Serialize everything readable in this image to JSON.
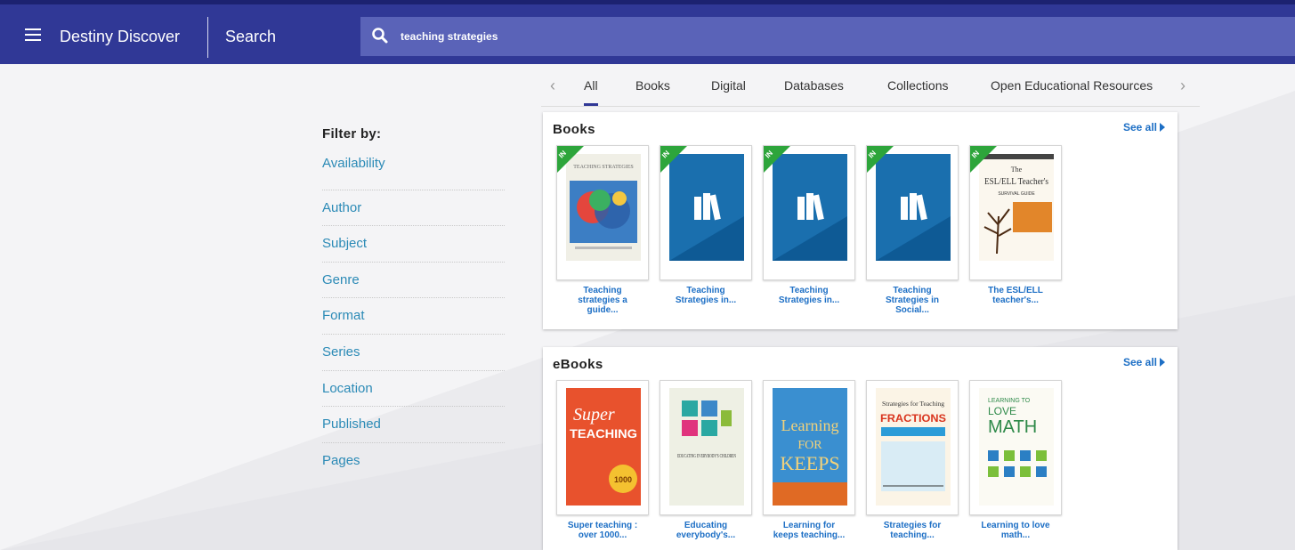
{
  "header": {
    "app_title": "Destiny Discover",
    "page_label": "Search",
    "search_value": "teaching strategies",
    "colors": {
      "bar": "#303896",
      "search_bg": "#5a63b8"
    }
  },
  "filters": {
    "heading": "Filter by:",
    "items": [
      "Availability",
      "Author",
      "Subject",
      "Genre",
      "Format",
      "Series",
      "Location",
      "Published",
      "Pages"
    ]
  },
  "tabs": {
    "items": [
      "All",
      "Books",
      "Digital",
      "Databases",
      "Collections",
      "Open Educational Resources"
    ],
    "active": "All",
    "prev_icon": "chevron-left-icon",
    "next_icon": "chevron-right-icon"
  },
  "books_panel": {
    "title": "Books",
    "see_all": "See all",
    "badge": "IN",
    "items": [
      {
        "title": "Teaching strategies a guide...",
        "available": "IN"
      },
      {
        "title": "Teaching Strategies in...",
        "available": "IN"
      },
      {
        "title": "Teaching Strategies in...",
        "available": "IN"
      },
      {
        "title": "Teaching Strategies in Social...",
        "available": "IN"
      },
      {
        "title": "The ESL/ELL teacher's...",
        "available": "IN"
      }
    ]
  },
  "ebooks_panel": {
    "title": "eBooks",
    "see_all": "See all",
    "items": [
      {
        "title": "Super teaching : over 1000..."
      },
      {
        "title": "Educating everybody's..."
      },
      {
        "title": "Learning for keeps teaching..."
      },
      {
        "title": "Strategies for teaching..."
      },
      {
        "title": "Learning to love math..."
      }
    ]
  },
  "cover_text": {
    "b1": "TEACHING STRATEGIES",
    "b5_the": "The",
    "b5_title": "ESL/ELL Teacher's",
    "b5_sub": "SURVIVAL GUIDE",
    "e1_a": "Super",
    "e1_b": "TEACHING",
    "e1_c": "1000",
    "e2": "EDUCATING EVERYBODY'S CHILDREN",
    "e3_a": "Learning",
    "e3_b": "FOR",
    "e3_c": "KEEPS",
    "e4_a": "Strategies for Teaching",
    "e4_b": "FRACTIONS",
    "e5_a": "LEARNING TO",
    "e5_b": "LOVE",
    "e5_c": "MATH"
  }
}
